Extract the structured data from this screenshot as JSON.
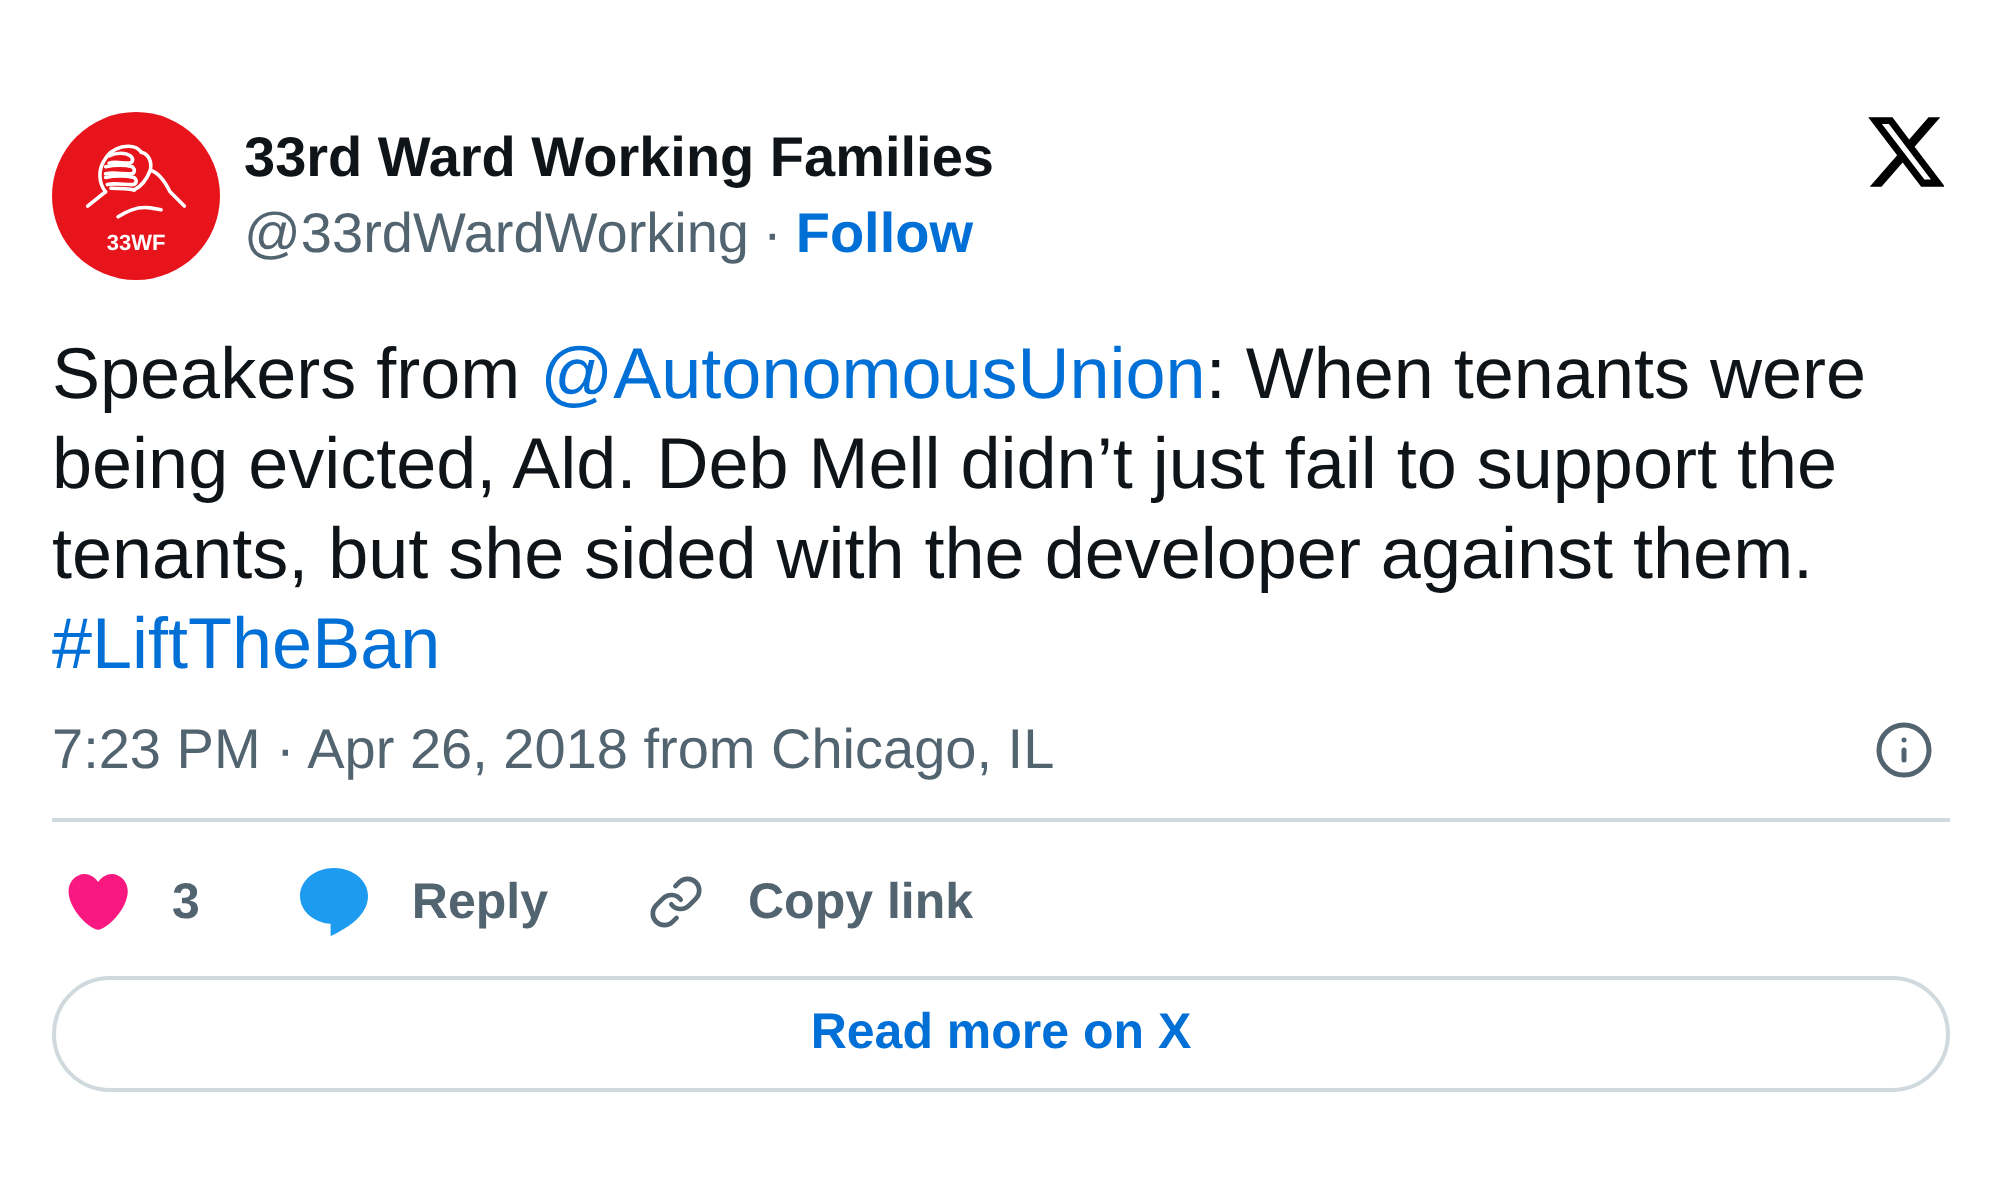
{
  "author": {
    "avatar_text": "33WF",
    "name": "33rd Ward Working Families",
    "handle": "@33rdWardWorking",
    "separator": "·",
    "follow": "Follow"
  },
  "post": {
    "segments": [
      {
        "kind": "text",
        "text": "Speakers from "
      },
      {
        "kind": "mention",
        "text": "@AutonomousUnion"
      },
      {
        "kind": "text",
        "text": ": When tenants were being evicted, Ald. Deb Mell didn’t just fail to support the tenants, but she sided with the developer against them. "
      },
      {
        "kind": "hashtag",
        "text": "#LiftTheBan"
      }
    ]
  },
  "meta": {
    "timestamp": "7:23 PM · Apr 26, 2018 from Chicago, IL"
  },
  "actions": [
    {
      "kind": "like",
      "label": "3"
    },
    {
      "kind": "reply",
      "label": "Reply"
    },
    {
      "kind": "copy",
      "label": "Copy link"
    }
  ],
  "read_more": "Read more on X"
}
